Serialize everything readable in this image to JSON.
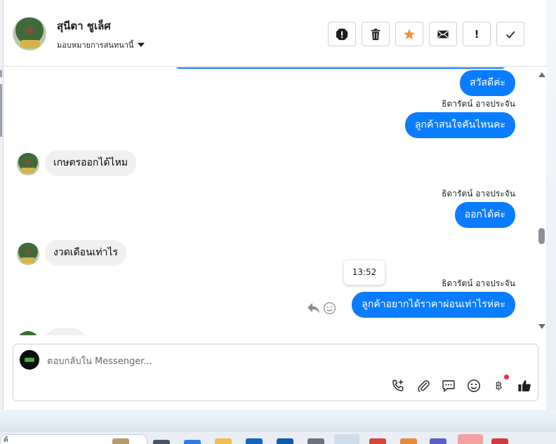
{
  "header": {
    "contact_name": "สุนีตา ชูเล็ศ",
    "assign_label": "มอบหมายการสนทนานี้"
  },
  "toolbar": {
    "buttons": [
      {
        "name": "spam-icon"
      },
      {
        "name": "trash-icon"
      },
      {
        "name": "star-icon",
        "color": "#f5923e"
      },
      {
        "name": "mail-icon"
      },
      {
        "name": "follow-up-icon",
        "label": "!"
      },
      {
        "name": "check-icon"
      }
    ]
  },
  "messages": {
    "m1": {
      "text": "สวัสดีค่ะ"
    },
    "s2": "ธิดารัตน์ อาจประจัน",
    "m2": {
      "text": "ลูกค้าสนใจคันไหนคะ"
    },
    "m3": {
      "text": "เกษตรออกได้ไหม"
    },
    "s4": "ธิดารัตน์ อาจประจัน",
    "m4": {
      "text": "ออกได้ค่ะ"
    },
    "m5": {
      "text": "งวดเดือนเท่าไร"
    },
    "tooltip": "13:52",
    "s6": "ธิดารัตน์ อาจประจัน",
    "m6": {
      "text": "ลูกค้าอยากได้ราคาผ่อนเท่าไรห่คะ"
    }
  },
  "composer": {
    "placeholder": "ตอบกลับใน Messenger...",
    "tools": [
      "call-add-icon",
      "attach-icon",
      "saved-reply-icon",
      "emoji-icon",
      "baht-payment-icon",
      "like-icon"
    ],
    "baht_symbol": "฿"
  },
  "taskbar": {
    "search_text": "ค้"
  },
  "colors": {
    "accent": "#0a7cff",
    "incoming": "#f0f0f0",
    "star": "#f5923e",
    "badge": "#f02849"
  }
}
